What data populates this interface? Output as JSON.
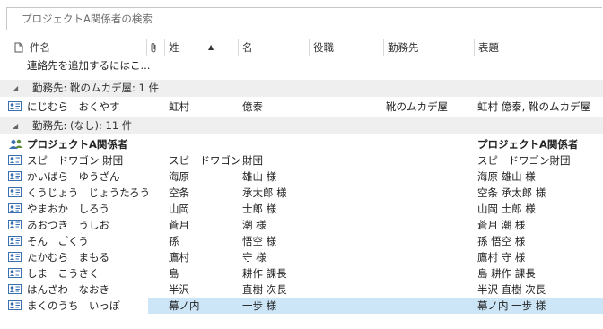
{
  "search": {
    "placeholder": "プロジェクトA関係者の検索"
  },
  "columns": {
    "name": "件名",
    "last": "姓",
    "first": "名",
    "role": "役職",
    "company": "勤務先",
    "title": "表題"
  },
  "add_contact_hint": "連絡先を追加するにはこ...",
  "groups": [
    {
      "label": "勤務先: 靴のムカデ屋: 1 件",
      "rows": [
        {
          "name": "にじむら　おくやす",
          "last": "虹村",
          "first": "億泰",
          "company": "靴のムカデ屋",
          "title": "虹村 億泰, 靴のムカデ屋"
        }
      ]
    },
    {
      "label": "勤務先: (なし): 11 件",
      "list_row": {
        "name": "プロジェクトA関係者",
        "title": "プロジェクトA関係者"
      },
      "rows": [
        {
          "name": "スピードワゴン 財団",
          "last": "スピードワゴン",
          "first": "財団",
          "company": "",
          "title": "スピードワゴン財団"
        },
        {
          "name": "かいばら　ゆうざん",
          "last": "海原",
          "first": "雄山 様",
          "company": "",
          "title": "海原 雄山 様"
        },
        {
          "name": "くうじょう　じょうたろう",
          "last": "空条",
          "first": "承太郎 様",
          "company": "",
          "title": "空条 承太郎 様"
        },
        {
          "name": "やまおか　しろう",
          "last": "山岡",
          "first": "士郎 様",
          "company": "",
          "title": "山岡 士郎 様"
        },
        {
          "name": "あおつき　うしお",
          "last": "蒼月",
          "first": "潮 様",
          "company": "",
          "title": "蒼月 潮 様"
        },
        {
          "name": "そん　ごくう",
          "last": "孫",
          "first": "悟空 様",
          "company": "",
          "title": "孫 悟空 様"
        },
        {
          "name": "たかむら　まもる",
          "last": "鷹村",
          "first": "守 様",
          "company": "",
          "title": "鷹村 守 様"
        },
        {
          "name": "しま　こうさく",
          "last": "島",
          "first": "耕作 課長",
          "company": "",
          "title": "島 耕作 課長"
        },
        {
          "name": "はんざわ　なおき",
          "last": "半沢",
          "first": "直樹 次長",
          "company": "",
          "title": "半沢 直樹 次長"
        },
        {
          "name": "まくのうち　いっぽ",
          "last": "幕ノ内",
          "first": "一歩 様",
          "company": "",
          "title": "幕ノ内 一歩 様",
          "selected": true
        }
      ]
    }
  ],
  "colors": {
    "selection": "#cde6f7",
    "group_header": "#efefef",
    "contact_icon": "#3a6fb0"
  }
}
